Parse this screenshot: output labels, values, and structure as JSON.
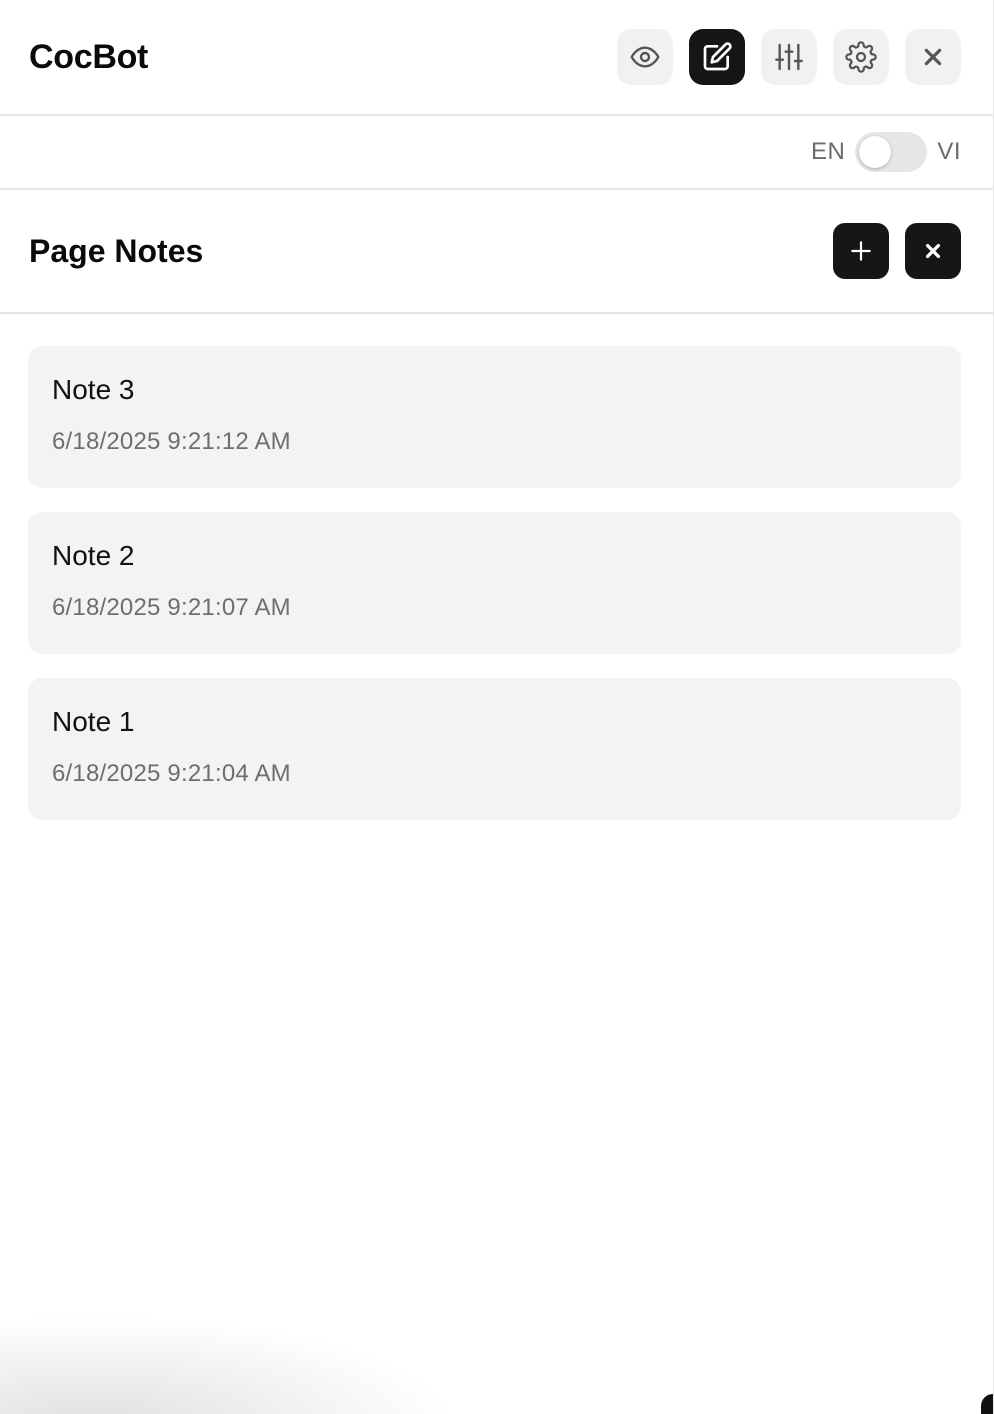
{
  "app": {
    "title": "CocBot"
  },
  "toolbar": {
    "buttons": [
      {
        "icon": "eye-icon",
        "active": false
      },
      {
        "icon": "edit-note-icon",
        "active": true
      },
      {
        "icon": "sliders-icon",
        "active": false
      },
      {
        "icon": "gear-icon",
        "active": false
      },
      {
        "icon": "close-icon",
        "active": false
      }
    ]
  },
  "language": {
    "left_label": "EN",
    "right_label": "VI",
    "selected": "EN"
  },
  "section": {
    "title": "Page Notes",
    "add_icon": "plus-icon",
    "clear_icon": "close-icon"
  },
  "notes": [
    {
      "title": "Note 3",
      "timestamp": "6/18/2025 9:21:12 AM"
    },
    {
      "title": "Note 2",
      "timestamp": "6/18/2025 9:21:07 AM"
    },
    {
      "title": "Note 1",
      "timestamp": "6/18/2025 9:21:04 AM"
    }
  ],
  "colors": {
    "accent": "#161616",
    "card_background": "#f3f3f3",
    "muted_text": "#6e6e6e"
  }
}
